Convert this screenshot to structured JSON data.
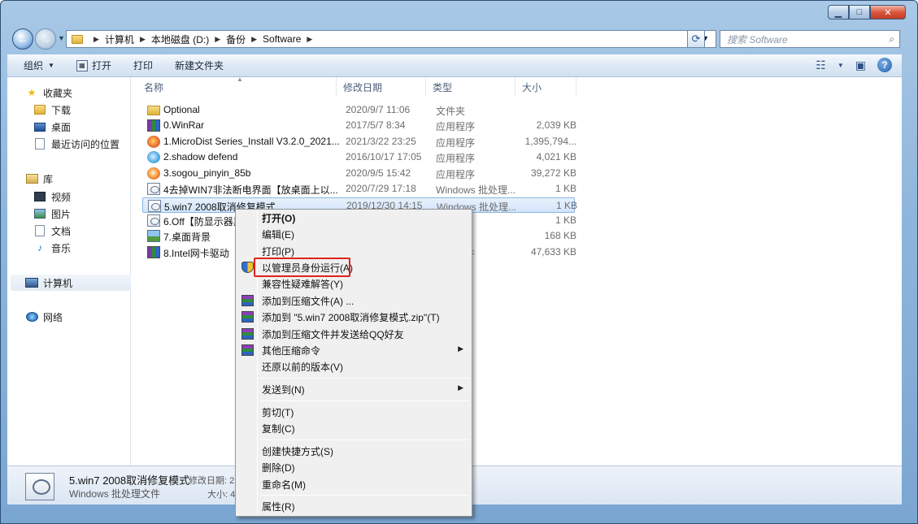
{
  "window": {
    "buttons": {
      "minimize": "▁",
      "maximize": "□",
      "close": "✕"
    }
  },
  "nav": {
    "back": "←",
    "forward": "→",
    "breadcrumb": [
      "计算机",
      "本地磁盘 (D:)",
      "备份",
      "Software"
    ],
    "search_placeholder": "搜索 Software"
  },
  "toolbar": {
    "organize": "组织",
    "open": "打开",
    "print": "打印",
    "new_folder": "新建文件夹"
  },
  "sidebar": {
    "favorites": "收藏夹",
    "downloads": "下载",
    "desktop": "桌面",
    "recent": "最近访问的位置",
    "libraries": "库",
    "videos": "视频",
    "pictures": "图片",
    "documents": "文档",
    "music": "音乐",
    "computer": "计算机",
    "network": "网络"
  },
  "columns": {
    "name": "名称",
    "date": "修改日期",
    "type": "类型",
    "size": "大小"
  },
  "files": [
    {
      "name": "Optional",
      "date": "2020/9/7 11:06",
      "type": "文件夹",
      "size": "",
      "icon": "folder-icon"
    },
    {
      "name": "0.WinRar",
      "date": "2017/5/7 8:34",
      "type": "应用程序",
      "size": "2,039 KB",
      "icon": "winrar-icon"
    },
    {
      "name": "1.MicroDist Series_Install V3.2.0_2021...",
      "date": "2021/3/22 23:25",
      "type": "应用程序",
      "size": "1,395,794...",
      "icon": "installer-icon"
    },
    {
      "name": "2.shadow defend",
      "date": "2016/10/17 17:05",
      "type": "应用程序",
      "size": "4,021 KB",
      "icon": "shield-app-icon"
    },
    {
      "name": "3.sogou_pinyin_85b",
      "date": "2020/9/5 15:42",
      "type": "应用程序",
      "size": "39,272 KB",
      "icon": "sogou-icon"
    },
    {
      "name": "4去掉WIN7非法断电界面【放桌面上以...",
      "date": "2020/7/29 17:18",
      "type": "Windows 批处理...",
      "size": "1 KB",
      "icon": "batch-file-icon"
    },
    {
      "name": "5.win7 2008取消修复模式",
      "date": "2019/12/30 14:15",
      "type": "Windows 批处理...",
      "size": "1 KB",
      "icon": "batch-file-icon"
    },
    {
      "name": "6.Off【防显示器黑",
      "date": "",
      "type": "批处理...",
      "size": "1 KB",
      "icon": "batch-file-icon"
    },
    {
      "name": "7.桌面背景",
      "date": "",
      "type": "",
      "size": "168 KB",
      "icon": "image-file-icon"
    },
    {
      "name": "8.Intel网卡驱动",
      "date": "",
      "type": "压缩文件",
      "size": "47,633 KB",
      "icon": "archive-icon"
    }
  ],
  "context_menu": {
    "open": "打开(O)",
    "edit": "编辑(E)",
    "print": "打印(P)",
    "run_as_admin": "以管理员身份运行(A)",
    "compat": "兼容性疑难解答(Y)",
    "add_archive": "添加到压缩文件(A) ...",
    "add_zip": "添加到 \"5.win7 2008取消修复模式.zip\"(T)",
    "add_send_qq": "添加到压缩文件并发送给QQ好友",
    "other_compress": "其他压缩命令",
    "restore": "还原以前的版本(V)",
    "send_to": "发送到(N)",
    "cut": "剪切(T)",
    "copy": "复制(C)",
    "shortcut": "创建快捷方式(S)",
    "delete": "删除(D)",
    "rename": "重命名(M)",
    "properties": "属性(R)"
  },
  "details": {
    "name": "5.win7 2008取消修复模式",
    "type": "Windows 批处理文件",
    "modified_label": "修改日期: 2",
    "size_label": "大小: 4"
  },
  "colors": {
    "highlight": "#e0231f",
    "selection": "#d3e5fa"
  }
}
